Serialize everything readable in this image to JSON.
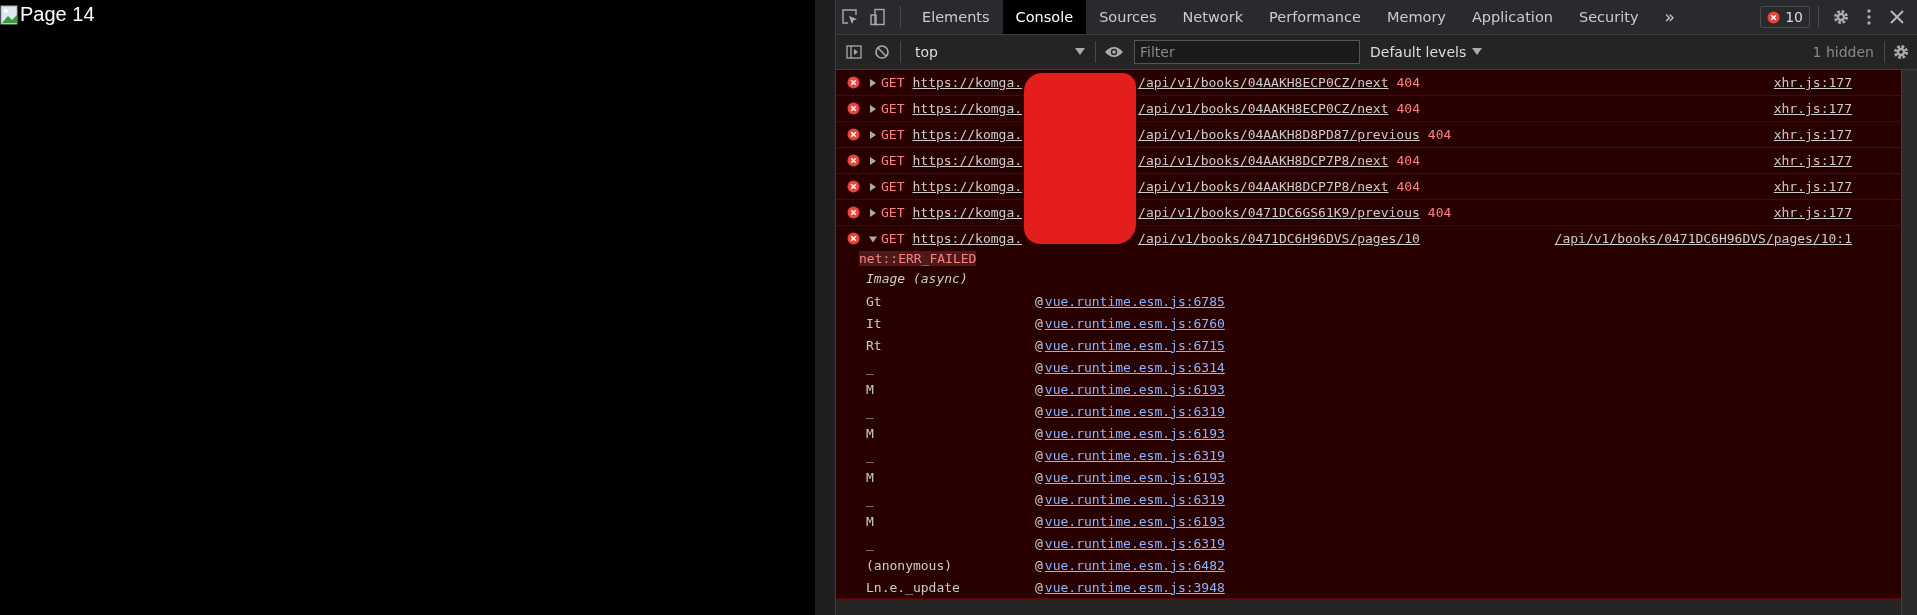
{
  "page": {
    "image_alt": "Page 14"
  },
  "devtools": {
    "tabs": [
      {
        "label": "Elements",
        "selected": false
      },
      {
        "label": "Console",
        "selected": true
      },
      {
        "label": "Sources",
        "selected": false
      },
      {
        "label": "Network",
        "selected": false
      },
      {
        "label": "Performance",
        "selected": false
      },
      {
        "label": "Memory",
        "selected": false
      },
      {
        "label": "Application",
        "selected": false
      },
      {
        "label": "Security",
        "selected": false
      }
    ],
    "more_tabs": "»",
    "error_count": "10",
    "toolbar": {
      "context": "top",
      "filter_placeholder": "Filter",
      "levels": "Default levels",
      "hidden": "1 hidden"
    },
    "messages": [
      {
        "method": "GET",
        "url_start": "https://komga.",
        "url_end": "/api/v1/books/04AAKH8ECP0CZ/next",
        "status": "404",
        "source": "xhr.js:177",
        "expanded": false
      },
      {
        "method": "GET",
        "url_start": "https://komga.",
        "url_end": "/api/v1/books/04AAKH8ECP0CZ/next",
        "status": "404",
        "source": "xhr.js:177",
        "expanded": false
      },
      {
        "method": "GET",
        "url_start": "https://komga.",
        "url_end": "/api/v1/books/04AAKH8D8PD87/previous",
        "status": "404",
        "source": "xhr.js:177",
        "expanded": false
      },
      {
        "method": "GET",
        "url_start": "https://komga.",
        "url_end": "/api/v1/books/04AAKH8DCP7P8/next",
        "status": "404",
        "source": "xhr.js:177",
        "expanded": false
      },
      {
        "method": "GET",
        "url_start": "https://komga.",
        "url_end": "/api/v1/books/04AAKH8DCP7P8/next",
        "status": "404",
        "source": "xhr.js:177",
        "expanded": false
      },
      {
        "method": "GET",
        "url_start": "https://komga.",
        "url_end": "/api/v1/books/0471DC6GS61K9/previous",
        "status": "404",
        "source": "xhr.js:177",
        "expanded": false
      },
      {
        "method": "GET",
        "url_start": "https://komga.",
        "url_end": "/api/v1/books/0471DC6H96DVS/pages/10",
        "error": "net::ERR_FAILED",
        "source": "/api/v1/books/0471DC6H96DVS/pages/10:1",
        "expanded": true,
        "async_label": "Image (async)",
        "stack": [
          {
            "function": "Gt",
            "at": "@",
            "location": "vue.runtime.esm.js:6785"
          },
          {
            "function": "It",
            "at": "@",
            "location": "vue.runtime.esm.js:6760"
          },
          {
            "function": "Rt",
            "at": "@",
            "location": "vue.runtime.esm.js:6715"
          },
          {
            "function": "_",
            "at": "@",
            "location": "vue.runtime.esm.js:6314"
          },
          {
            "function": "M",
            "at": "@",
            "location": "vue.runtime.esm.js:6193"
          },
          {
            "function": "_",
            "at": "@",
            "location": "vue.runtime.esm.js:6319"
          },
          {
            "function": "M",
            "at": "@",
            "location": "vue.runtime.esm.js:6193"
          },
          {
            "function": "_",
            "at": "@",
            "location": "vue.runtime.esm.js:6319"
          },
          {
            "function": "M",
            "at": "@",
            "location": "vue.runtime.esm.js:6193"
          },
          {
            "function": "_",
            "at": "@",
            "location": "vue.runtime.esm.js:6319"
          },
          {
            "function": "M",
            "at": "@",
            "location": "vue.runtime.esm.js:6193"
          },
          {
            "function": "_",
            "at": "@",
            "location": "vue.runtime.esm.js:6319"
          },
          {
            "function": "(anonymous)",
            "at": "@",
            "location": "vue.runtime.esm.js:6482"
          },
          {
            "function": "Ln.e._update",
            "at": "@",
            "location": "vue.runtime.esm.js:3948"
          }
        ]
      }
    ]
  }
}
